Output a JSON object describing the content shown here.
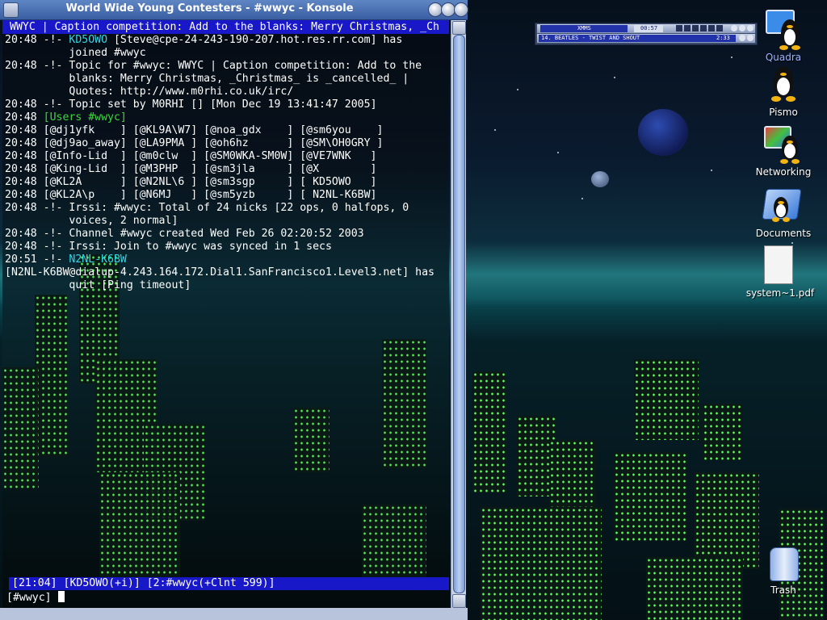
{
  "window": {
    "title": "World Wide Young Contesters - #wwyc - Konsole"
  },
  "terminal": {
    "topic_bar": "WWYC | Caption competition: Add to the blanks: Merry Christmas, _Ch",
    "lines": [
      {
        "t": "20:48 -!- ",
        "c": "KD5OWO",
        "r": " [Steve@cpe-24-243-190-207.hot.res.rr.com] has"
      },
      {
        "t": "          ",
        "c": "",
        "r": "joined #wwyc"
      },
      {
        "t": "20:48 -!- ",
        "c": "",
        "r": "Topic for #wwyc: WWYC | Caption competition: Add to the"
      },
      {
        "t": "          ",
        "c": "",
        "r": "blanks: Merry Christmas, _Christmas_ is _cancelled_ |"
      },
      {
        "t": "          ",
        "c": "",
        "r": "Quotes: http://www.m0rhi.co.uk/irc/"
      },
      {
        "t": "20:48 -!- ",
        "c": "",
        "r": "Topic set by M0RHI [] [Mon Dec 19 13:41:47 2005]"
      },
      {
        "t": "20:48 ",
        "c": "[Users #wwyc]",
        "r": ""
      },
      {
        "t": "20:48 ",
        "c": "",
        "r": "[@dj1yfk    ] [@KL9A\\W7] [@noa_gdx    ] [@sm6you    ]"
      },
      {
        "t": "20:48 ",
        "c": "",
        "r": "[@dj9ao_away] [@LA9PMA ] [@oh6hz      ] [@SM\\OH0GRY ]"
      },
      {
        "t": "20:48 ",
        "c": "",
        "r": "[@Info-Lid  ] [@m0clw  ] [@SM0WKA-SM0W] [@VE7WNK   ]"
      },
      {
        "t": "20:48 ",
        "c": "",
        "r": "[@King-Lid  ] [@M3PHP  ] [@sm3jla     ] [@X        ]"
      },
      {
        "t": "20:48 ",
        "c": "",
        "r": "[@KL2A      ] [@N2NL\\6 ] [@sm3sgp     ] [ KD5OWO   ]"
      },
      {
        "t": "20:48 ",
        "c": "",
        "r": "[@KL2A\\p    ] [@N6MJ   ] [@sm5yzb     ] [ N2NL-K6BW]"
      },
      {
        "t": "20:48 -!- ",
        "c": "",
        "r": "Irssi: #wwyc: Total of 24 nicks [22 ops, 0 halfops, 0"
      },
      {
        "t": "          ",
        "c": "",
        "r": "voices, 2 normal]"
      },
      {
        "t": "20:48 -!- ",
        "c": "",
        "r": "Channel #wwyc created Wed Feb 26 02:20:52 2003"
      },
      {
        "t": "20:48 -!- ",
        "c": "",
        "r": "Irssi: Join to #wwyc was synced in 1 secs"
      },
      {
        "t": "20:51 -!- ",
        "c": "N2NL-K6BW",
        "r": ""
      },
      {
        "t": "",
        "c": "",
        "r": "[N2NL-K6BW@dialup-4.243.164.172.Dial1.SanFrancisco1.Level3.net] has"
      },
      {
        "t": "          ",
        "c": "",
        "r": "quit [Ping timeout]"
      }
    ],
    "status_bar": "[21:04] [KD5OWO(+i)] [2:#wwyc(+Clnt 599)]",
    "prompt": "[#wwyc] "
  },
  "xmms": {
    "title": "XMMS",
    "time": "00:57",
    "track": "14. BEATLES - TWIST AND SHOUT",
    "duration": "2:33"
  },
  "desktop_icons": [
    {
      "label": "Quadra"
    },
    {
      "label": "Pismo"
    },
    {
      "label": "Networking"
    },
    {
      "label": "Documents"
    },
    {
      "label": "system~1.pdf"
    },
    {
      "label": "Trash"
    }
  ],
  "colors": {
    "title_bar": "#4a6fb0",
    "irc_bar": "#1818c8",
    "nick_cyan": "#2fd8e8",
    "window_lights": "#5cff5c"
  }
}
